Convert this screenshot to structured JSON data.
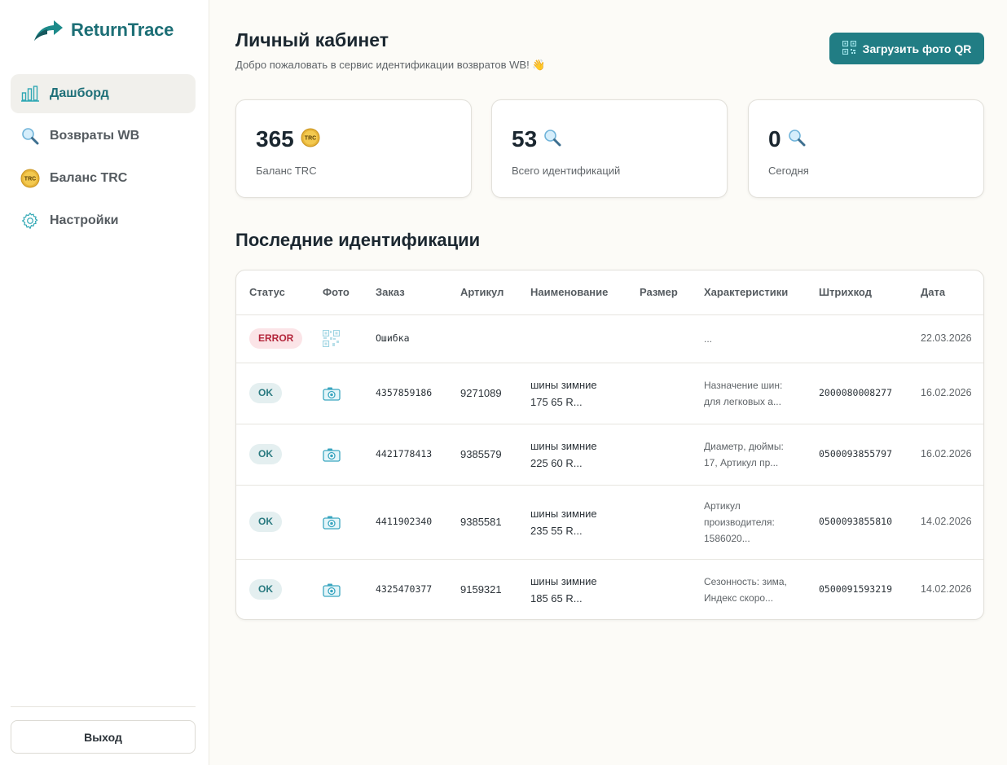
{
  "brand": {
    "name": "ReturnTrace"
  },
  "nav": {
    "items": [
      {
        "label": "Дашборд",
        "icon": "bar-chart-icon",
        "active": true
      },
      {
        "label": "Возвраты WB",
        "icon": "magnifier-icon",
        "active": false
      },
      {
        "label": "Баланс TRC",
        "icon": "trc-coin-icon",
        "active": false
      },
      {
        "label": "Настройки",
        "icon": "gear-icon",
        "active": false
      }
    ],
    "logout_label": "Выход"
  },
  "header": {
    "title": "Личный кабинет",
    "subtitle": "Добро пожаловать в сервис идентификации возвратов WB! 👋",
    "upload_button": "Загрузить фото QR"
  },
  "stats": [
    {
      "value": "365",
      "label": "Баланс TRC",
      "icon": "trc-coin-icon",
      "coin_text": "TRC"
    },
    {
      "value": "53",
      "label": "Всего идентификаций",
      "icon": "magnifier-icon"
    },
    {
      "value": "0",
      "label": "Сегодня",
      "icon": "magnifier-icon"
    }
  ],
  "recent": {
    "title": "Последние идентификации",
    "columns": [
      "Статус",
      "Фото",
      "Заказ",
      "Артикул",
      "Наименование",
      "Размер",
      "Характеристики",
      "Штрихкод",
      "Дата"
    ],
    "rows": [
      {
        "status": "ERROR",
        "photo": "qr-code-icon",
        "order": "Ошибка",
        "article": "",
        "name_1": "",
        "name_2": "",
        "size": "",
        "char_1": "...",
        "char_2": "",
        "char_3": "",
        "barcode": "",
        "date": "22.03.2026"
      },
      {
        "status": "OK",
        "photo": "camera-icon",
        "order": "4357859186",
        "article": "9271089",
        "name_1": "шины зимние",
        "name_2": "175 65 R...",
        "size": "",
        "char_1": "Назначение шин:",
        "char_2": "для легковых а...",
        "char_3": "",
        "barcode": "2000080008277",
        "date": "16.02.2026"
      },
      {
        "status": "OK",
        "photo": "camera-icon",
        "order": "4421778413",
        "article": "9385579",
        "name_1": "шины зимние",
        "name_2": "225 60 R...",
        "size": "",
        "char_1": "Диаметр, дюймы:",
        "char_2": "17, Артикул пр...",
        "char_3": "",
        "barcode": "0500093855797",
        "date": "16.02.2026"
      },
      {
        "status": "OK",
        "photo": "camera-icon",
        "order": "4411902340",
        "article": "9385581",
        "name_1": "шины зимние",
        "name_2": "235 55 R...",
        "size": "",
        "char_1": "Артикул",
        "char_2": "производителя:",
        "char_3": "1586020...",
        "barcode": "0500093855810",
        "date": "14.02.2026"
      },
      {
        "status": "OK",
        "photo": "camera-icon",
        "order": "4325470377",
        "article": "9159321",
        "name_1": "шины зимние",
        "name_2": "185 65 R...",
        "size": "",
        "char_1": "Сезонность: зима,",
        "char_2": "Индекс скоро...",
        "char_3": "",
        "barcode": "0500091593219",
        "date": "14.02.2026"
      }
    ]
  },
  "colors": {
    "accent": "#217d84",
    "brand": "#1d6f76",
    "error_bg": "#fbe4e7",
    "error_text": "#b3263b",
    "ok_bg": "#e4eff0",
    "ok_text": "#2a7a80",
    "page_bg": "#fcfbf7"
  }
}
